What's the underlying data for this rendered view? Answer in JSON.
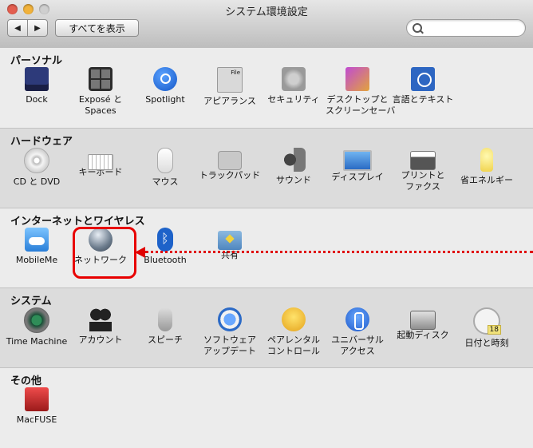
{
  "window": {
    "title": "システム環境設定",
    "show_all": "すべてを表示",
    "search_placeholder": ""
  },
  "sections": [
    {
      "title": "パーソナル",
      "items": [
        {
          "label": "Dock",
          "icon": "dock-icon"
        },
        {
          "label": "Exposé と\nSpaces",
          "icon": "expose-spaces-icon"
        },
        {
          "label": "Spotlight",
          "icon": "spotlight-icon"
        },
        {
          "label": "アピアランス",
          "icon": "appearance-icon"
        },
        {
          "label": "セキュリティ",
          "icon": "security-icon"
        },
        {
          "label": "デスクトップと\nスクリーンセーバ",
          "icon": "desktop-screensaver-icon"
        },
        {
          "label": "言語とテキスト",
          "icon": "language-text-icon"
        }
      ]
    },
    {
      "title": "ハードウェア",
      "items": [
        {
          "label": "CD と DVD",
          "icon": "cd-dvd-icon"
        },
        {
          "label": "キーボード",
          "icon": "keyboard-icon"
        },
        {
          "label": "マウス",
          "icon": "mouse-icon"
        },
        {
          "label": "トラックパッド",
          "icon": "trackpad-icon"
        },
        {
          "label": "サウンド",
          "icon": "sound-icon"
        },
        {
          "label": "ディスプレイ",
          "icon": "display-icon"
        },
        {
          "label": "プリントと\nファクス",
          "icon": "print-fax-icon"
        },
        {
          "label": "省エネルギー",
          "icon": "energy-saver-icon"
        }
      ]
    },
    {
      "title": "インターネットとワイヤレス",
      "items": [
        {
          "label": "MobileMe",
          "icon": "mobileme-icon"
        },
        {
          "label": "ネットワーク",
          "icon": "network-icon"
        },
        {
          "label": "Bluetooth",
          "icon": "bluetooth-icon"
        },
        {
          "label": "共有",
          "icon": "sharing-icon"
        }
      ]
    },
    {
      "title": "システム",
      "items": [
        {
          "label": "Time Machine",
          "icon": "time-machine-icon"
        },
        {
          "label": "アカウント",
          "icon": "accounts-icon"
        },
        {
          "label": "スピーチ",
          "icon": "speech-icon"
        },
        {
          "label": "ソフトウェア\nアップデート",
          "icon": "software-update-icon"
        },
        {
          "label": "ペアレンタル\nコントロール",
          "icon": "parental-controls-icon"
        },
        {
          "label": "ユニバーサル\nアクセス",
          "icon": "universal-access-icon"
        },
        {
          "label": "起動ディスク",
          "icon": "startup-disk-icon"
        },
        {
          "label": "日付と時刻",
          "icon": "date-time-icon"
        }
      ]
    },
    {
      "title": "その他",
      "items": [
        {
          "label": "MacFUSE",
          "icon": "macfuse-icon"
        }
      ]
    }
  ]
}
